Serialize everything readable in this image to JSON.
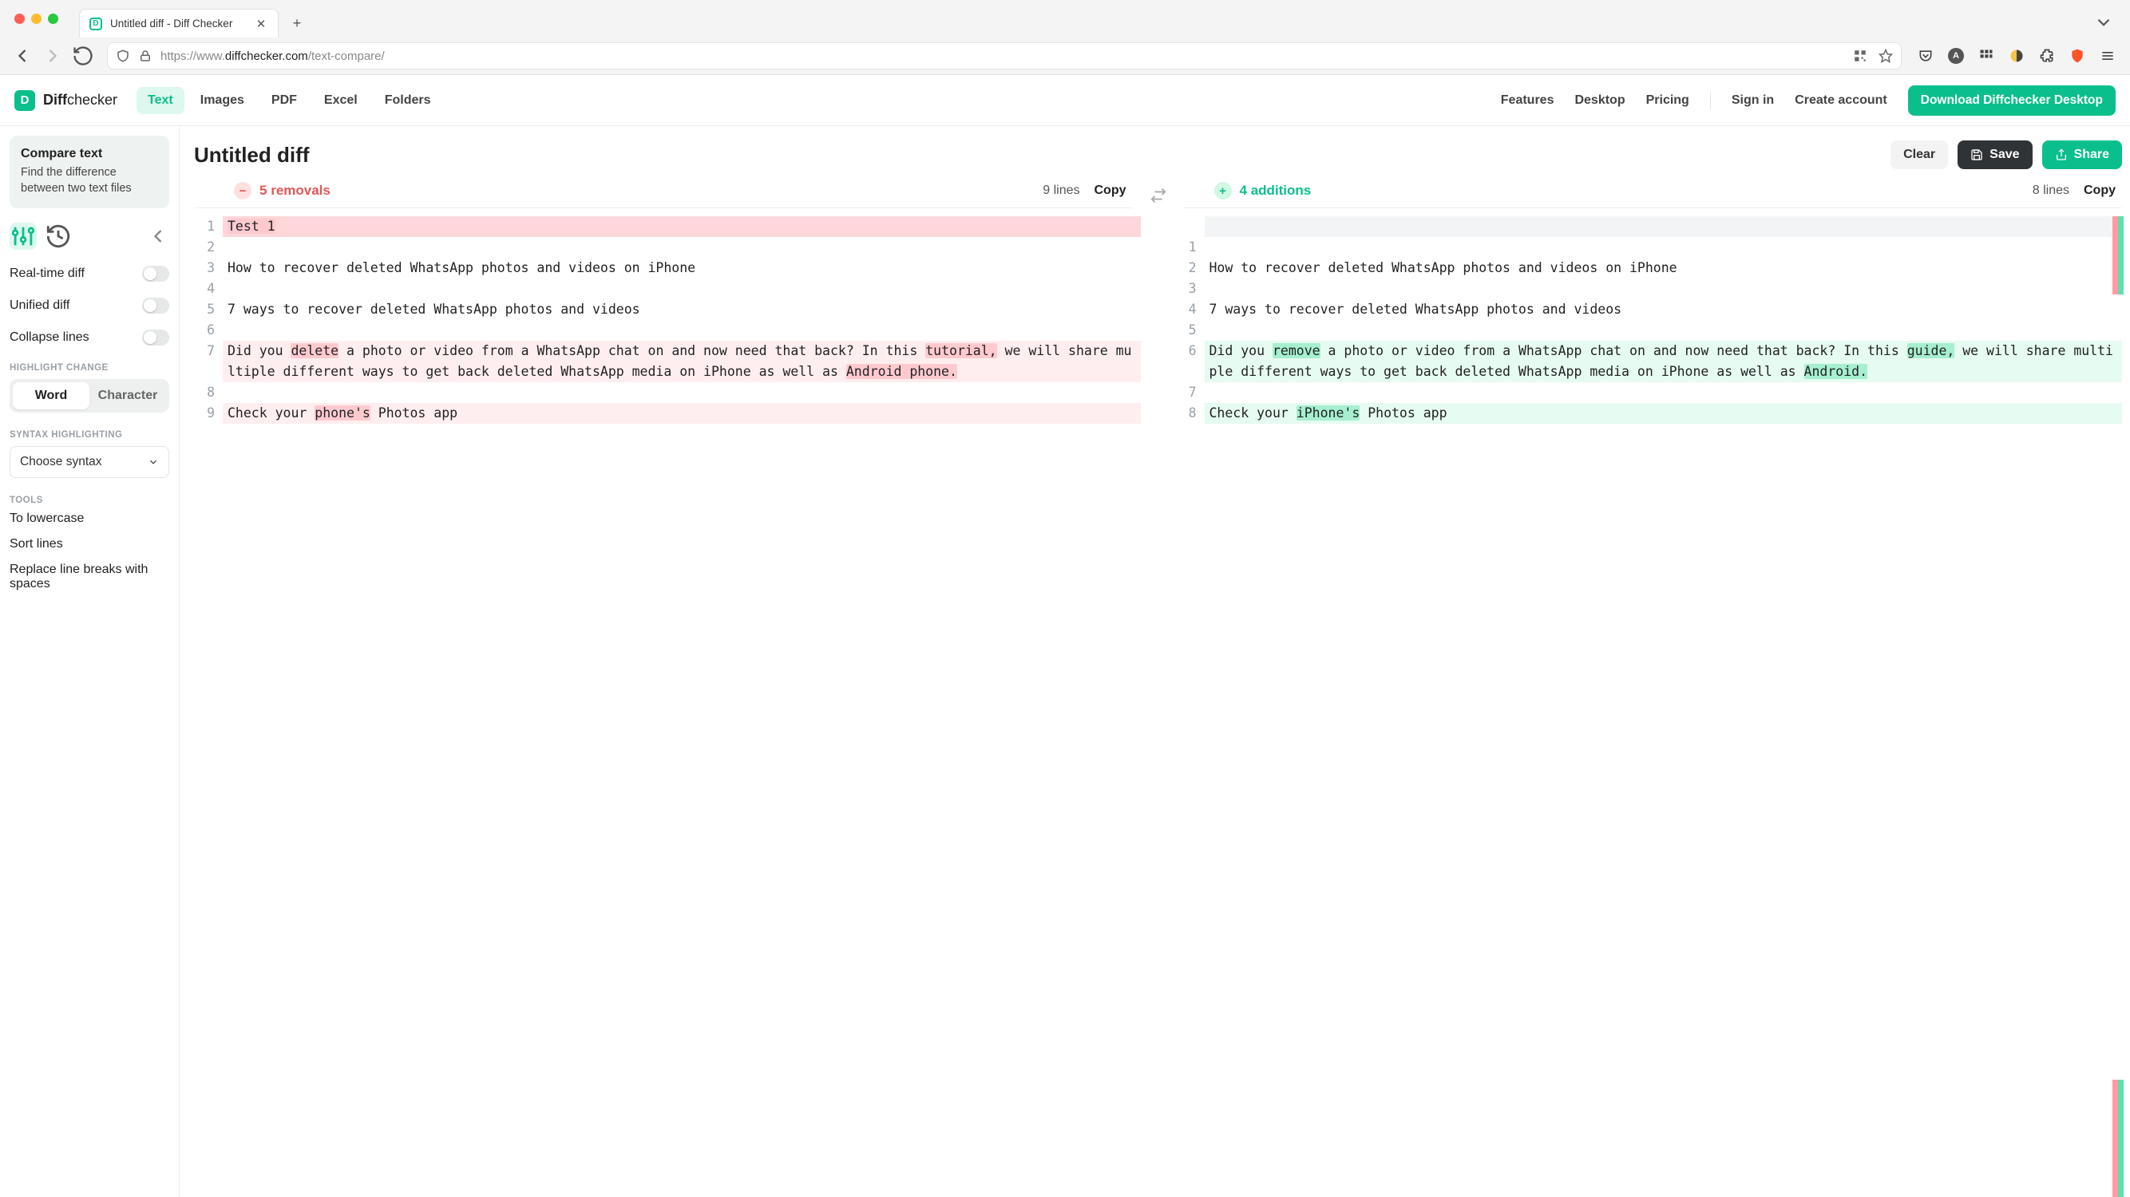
{
  "browser": {
    "tab_title": "Untitled diff - Diff Checker",
    "url_prefix": "https://www.",
    "url_host": "diffchecker.com",
    "url_path": "/text-compare/",
    "avatar_letter": "A"
  },
  "header": {
    "logo_mark": "D",
    "logo_name": "Diff",
    "logo_suffix": "checker",
    "tabs": [
      "Text",
      "Images",
      "PDF",
      "Excel",
      "Folders"
    ],
    "active_tab_index": 0,
    "right_links": [
      "Features",
      "Desktop",
      "Pricing"
    ],
    "signin": "Sign in",
    "create_account": "Create account",
    "cta": "Download Diffchecker Desktop"
  },
  "sidebar": {
    "card_title": "Compare text",
    "card_sub": "Find the difference between two text files",
    "toggles": [
      {
        "label": "Real-time diff",
        "on": false
      },
      {
        "label": "Unified diff",
        "on": false
      },
      {
        "label": "Collapse lines",
        "on": false
      }
    ],
    "highlight_label": "HIGHLIGHT CHANGE",
    "highlight_options": [
      "Word",
      "Character"
    ],
    "highlight_active": 0,
    "syntax_label": "SYNTAX HIGHLIGHTING",
    "syntax_value": "Choose syntax",
    "tools_label": "TOOLS",
    "tools": [
      "To lowercase",
      "Sort lines",
      "Replace line breaks with spaces"
    ]
  },
  "document": {
    "title": "Untitled diff",
    "clear": "Clear",
    "save": "Save",
    "share": "Share"
  },
  "summary": {
    "removals_count": 5,
    "removals_label": "removals",
    "additions_count": 4,
    "additions_label": "additions",
    "left_lines": 9,
    "right_lines": 8,
    "lines_word": "lines",
    "copy": "Copy"
  },
  "diff": {
    "left": [
      {
        "n": 1,
        "kind": "removed-full",
        "segments": [
          {
            "t": "Test 1",
            "m": "rem"
          }
        ]
      },
      {
        "n": 2,
        "kind": "ctx",
        "segments": [
          {
            "t": ""
          }
        ]
      },
      {
        "n": 3,
        "kind": "ctx",
        "segments": [
          {
            "t": "How to recover deleted WhatsApp photos and videos on iPhone"
          }
        ]
      },
      {
        "n": 4,
        "kind": "ctx",
        "segments": [
          {
            "t": ""
          }
        ]
      },
      {
        "n": 5,
        "kind": "ctx",
        "segments": [
          {
            "t": "7 ways to recover deleted WhatsApp photos and videos"
          }
        ]
      },
      {
        "n": 6,
        "kind": "ctx",
        "segments": [
          {
            "t": ""
          }
        ]
      },
      {
        "n": 7,
        "kind": "removed",
        "segments": [
          {
            "t": "Did you "
          },
          {
            "t": "delete",
            "m": "rem"
          },
          {
            "t": " a photo or video from a WhatsApp chat on and now need that back? In this "
          },
          {
            "t": "tutorial,",
            "m": "rem"
          },
          {
            "t": " we will share multiple different ways to get back deleted WhatsApp media on iPhone as well as "
          },
          {
            "t": "Android phone.",
            "m": "rem"
          }
        ]
      },
      {
        "n": 8,
        "kind": "ctx",
        "segments": [
          {
            "t": ""
          }
        ]
      },
      {
        "n": 9,
        "kind": "removed",
        "segments": [
          {
            "t": "Check your "
          },
          {
            "t": "phone's",
            "m": "rem"
          },
          {
            "t": " Photos app"
          }
        ]
      }
    ],
    "right": [
      {
        "n": null,
        "kind": "placeholder",
        "segments": [
          {
            "t": ""
          }
        ]
      },
      {
        "n": 1,
        "kind": "ctx",
        "segments": [
          {
            "t": ""
          }
        ]
      },
      {
        "n": 2,
        "kind": "ctx",
        "segments": [
          {
            "t": "How to recover deleted WhatsApp photos and videos on iPhone"
          }
        ]
      },
      {
        "n": 3,
        "kind": "ctx",
        "segments": [
          {
            "t": ""
          }
        ]
      },
      {
        "n": 4,
        "kind": "ctx",
        "segments": [
          {
            "t": "7 ways to recover deleted WhatsApp photos and videos"
          }
        ]
      },
      {
        "n": 5,
        "kind": "ctx",
        "segments": [
          {
            "t": ""
          }
        ]
      },
      {
        "n": 6,
        "kind": "added",
        "segments": [
          {
            "t": "Did you "
          },
          {
            "t": "remove",
            "m": "add"
          },
          {
            "t": " a photo or video from a WhatsApp chat on and now need that back? In this "
          },
          {
            "t": "guide,",
            "m": "add"
          },
          {
            "t": " we will share multiple different ways to get back deleted WhatsApp media on iPhone as well as "
          },
          {
            "t": "Android.",
            "m": "add"
          }
        ]
      },
      {
        "n": 7,
        "kind": "ctx",
        "segments": [
          {
            "t": ""
          }
        ]
      },
      {
        "n": 8,
        "kind": "added",
        "segments": [
          {
            "t": "Check your "
          },
          {
            "t": "iPhone's",
            "m": "add"
          },
          {
            "t": " Photos app"
          }
        ]
      }
    ]
  }
}
